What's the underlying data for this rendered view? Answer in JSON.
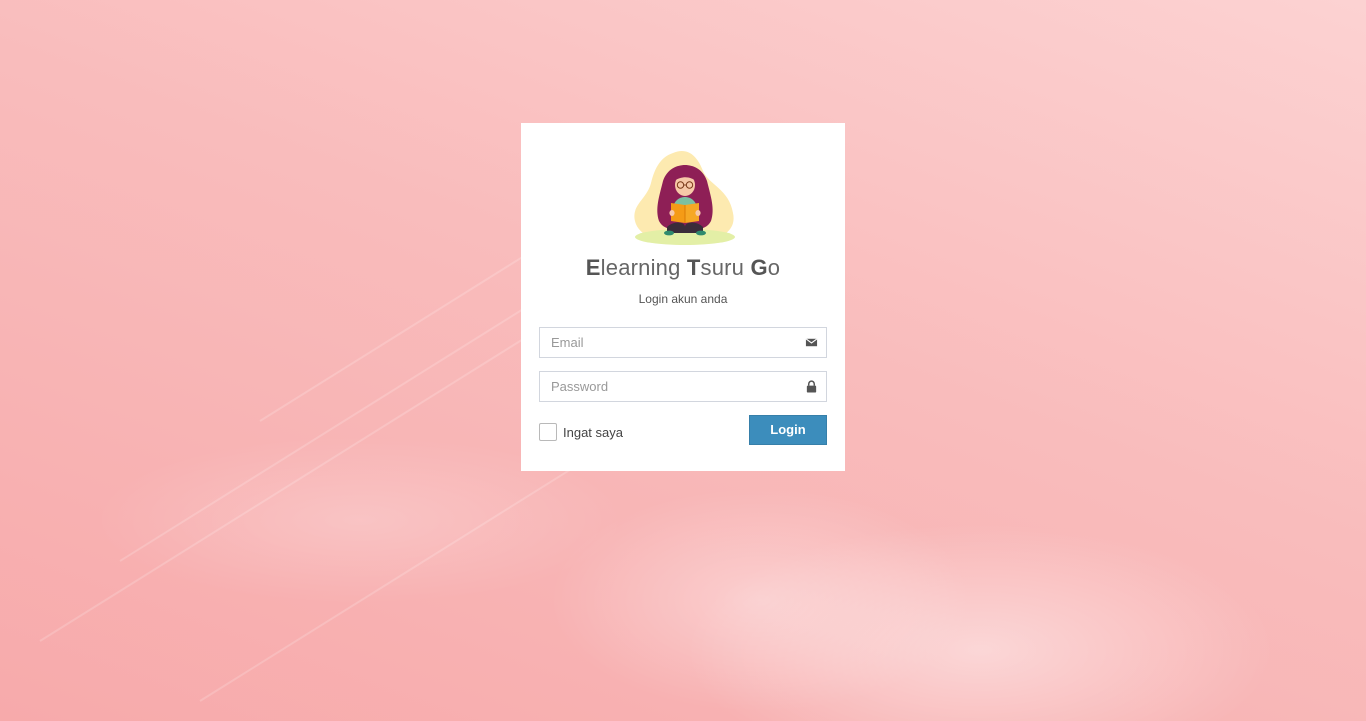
{
  "login": {
    "title_parts": [
      {
        "initial": "E",
        "rest": "learning "
      },
      {
        "initial": "T",
        "rest": "suru "
      },
      {
        "initial": "G",
        "rest": "o"
      }
    ],
    "subtitle": "Login akun anda",
    "email_placeholder": "Email",
    "email_value": "",
    "password_placeholder": "Password",
    "password_value": "",
    "remember_label": "Ingat saya",
    "remember_checked": false,
    "login_button_label": "Login"
  },
  "icons": {
    "email": "envelope-icon",
    "password": "lock-icon",
    "logo": "girl-reading-book-illustration"
  },
  "colors": {
    "background": "#f9bcbc",
    "card": "#ffffff",
    "button": "#3c8dbc",
    "title": "#666666"
  }
}
